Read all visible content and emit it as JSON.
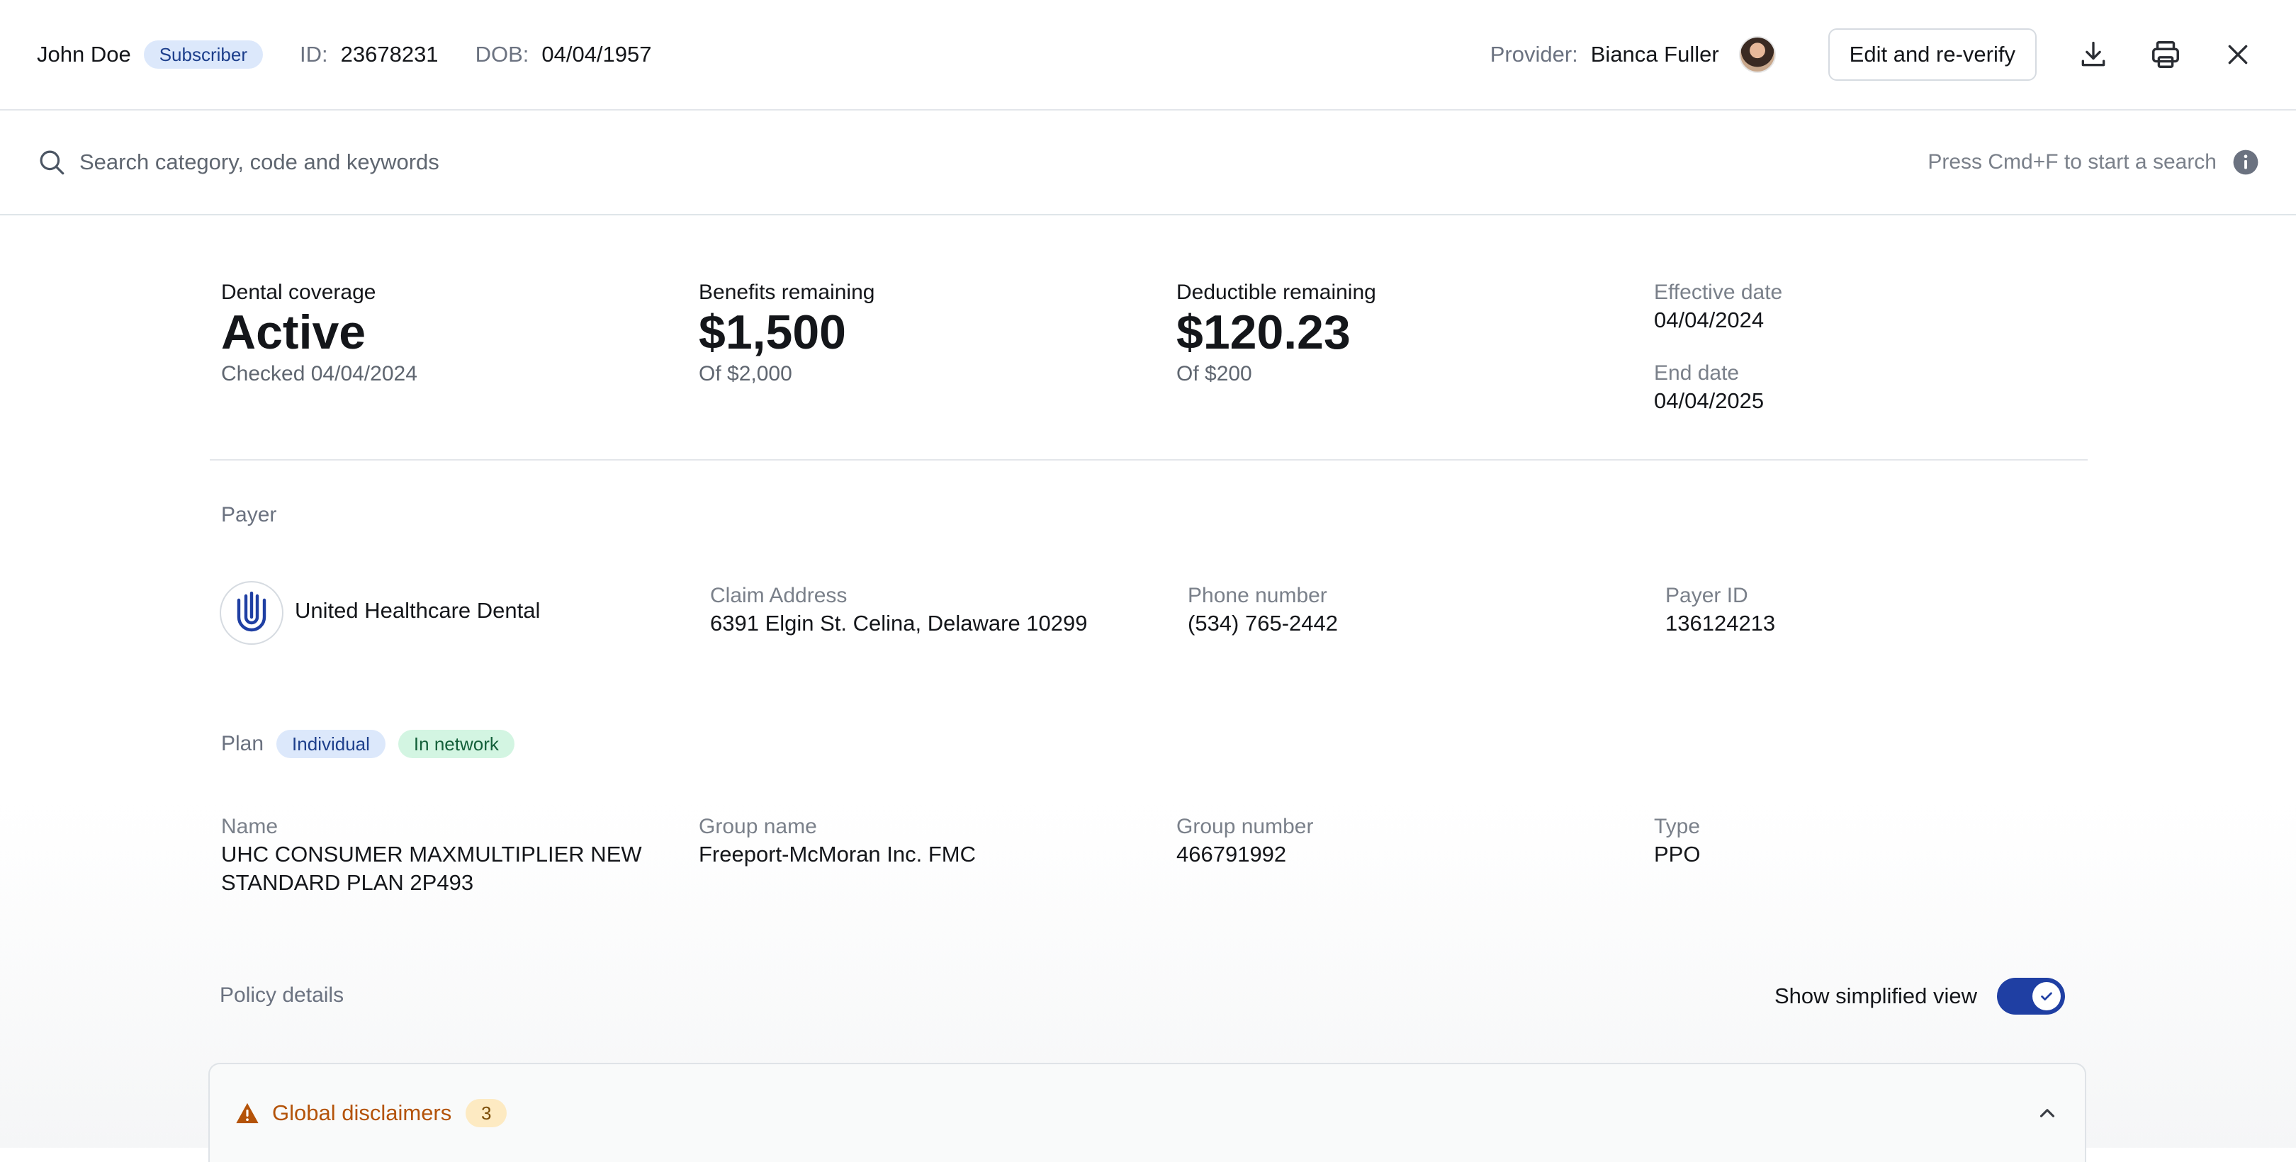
{
  "header": {
    "patient_name": "John Doe",
    "role_badge": "Subscriber",
    "id_label": "ID:",
    "id_value": "23678231",
    "dob_label": "DOB:",
    "dob_value": "04/04/1957",
    "provider_label": "Provider:",
    "provider_name": "Bianca Fuller",
    "edit_button": "Edit and re-verify",
    "icons": [
      "download-icon",
      "printer-icon",
      "close-icon"
    ]
  },
  "search": {
    "placeholder": "Search category, code and keywords",
    "hint": "Press Cmd+F to start a search"
  },
  "summary": {
    "coverage": {
      "label": "Dental coverage",
      "value": "Active",
      "sub": "Checked 04/04/2024"
    },
    "benefits": {
      "label": "Benefits remaining",
      "value": "$1,500",
      "sub": "Of $2,000"
    },
    "deductible": {
      "label": "Deductible remaining",
      "value": "$120.23",
      "sub": "Of $200"
    },
    "effective_label": "Effective date",
    "effective_value": "04/04/2024",
    "end_label": "End date",
    "end_value": "04/04/2025"
  },
  "payer": {
    "section_label": "Payer",
    "name": "United Healthcare Dental",
    "claim_address_label": "Claim Address",
    "claim_address": "6391 Elgin St. Celina, Delaware 10299",
    "phone_label": "Phone number",
    "phone": "(534) 765-2442",
    "payer_id_label": "Payer ID",
    "payer_id": "136124213"
  },
  "plan": {
    "section_label": "Plan",
    "badge_1": "Individual",
    "badge_2": "In network",
    "name_label": "Name",
    "name_line1": "UHC CONSUMER MAXMULTIPLIER NEW",
    "name_line2": "STANDARD PLAN 2P493",
    "group_name_label": "Group name",
    "group_name": "Freeport-McMoran Inc. FMC",
    "group_number_label": "Group number",
    "group_number": "466791992",
    "type_label": "Type",
    "type": "PPO"
  },
  "policy": {
    "section_label": "Policy details",
    "toggle_label": "Show simplified view",
    "toggle_on": true
  },
  "disclaimers": {
    "title": "Global disclaimers",
    "count": "3"
  },
  "colors": {
    "accent": "#1f3fa3",
    "warning": "#b45309",
    "badge_blue_bg": "#dce8fb",
    "badge_green_bg": "#d3f5e2"
  }
}
